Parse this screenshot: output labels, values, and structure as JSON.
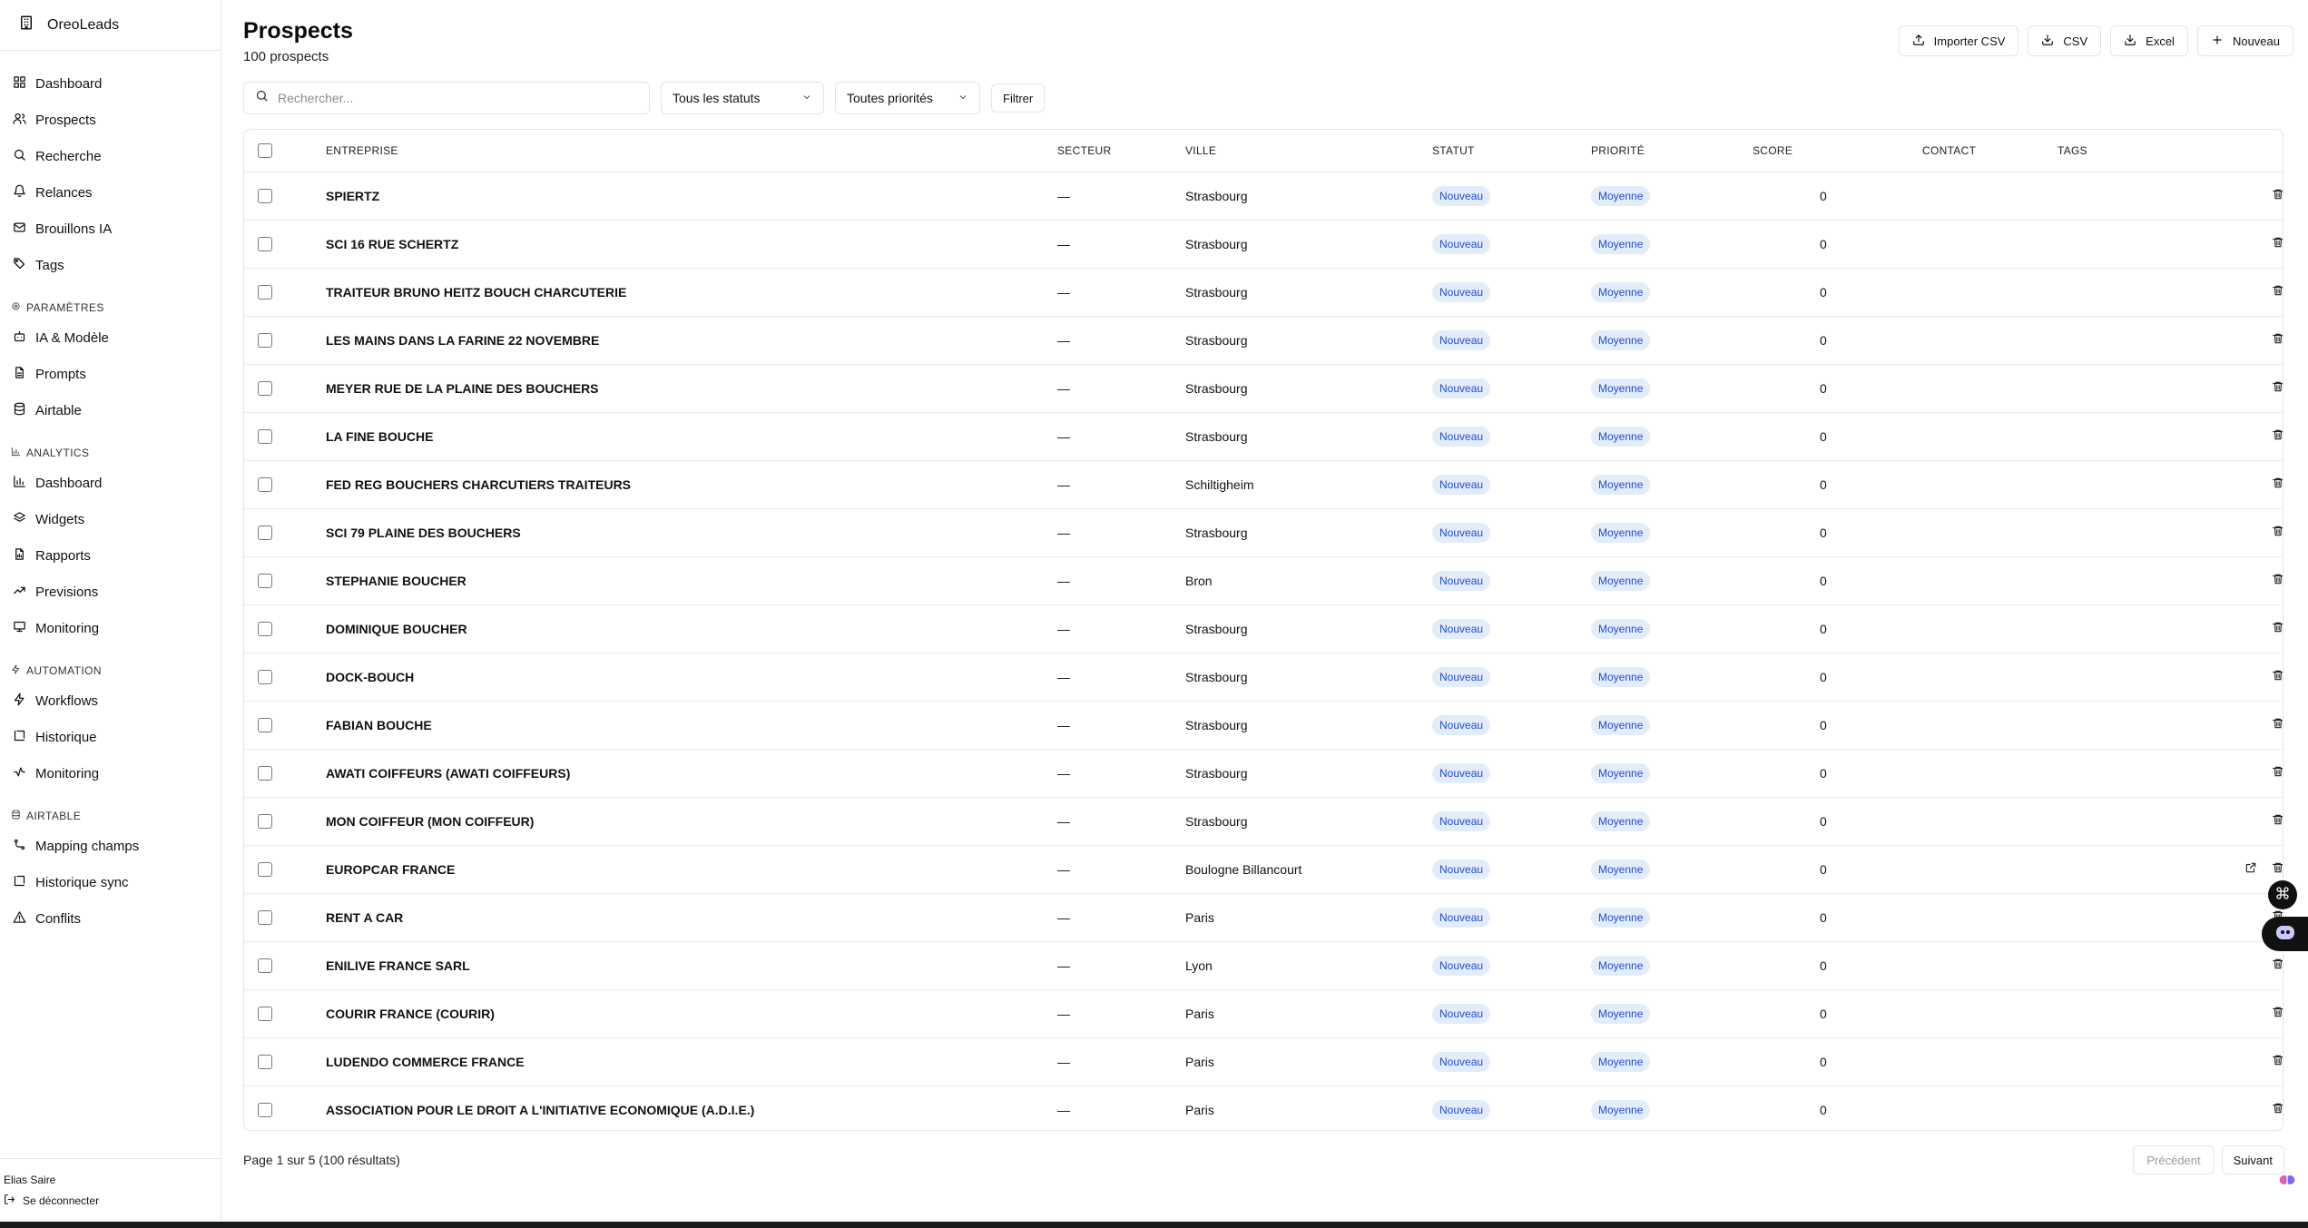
{
  "app": {
    "name": "OreoLeads"
  },
  "sidebar": {
    "main_items": [
      {
        "label": "Dashboard",
        "icon": "dashboard-icon"
      },
      {
        "label": "Prospects",
        "icon": "users-icon"
      },
      {
        "label": "Recherche",
        "icon": "search-icon"
      },
      {
        "label": "Relances",
        "icon": "bell-icon"
      },
      {
        "label": "Brouillons IA",
        "icon": "mail-icon"
      },
      {
        "label": "Tags",
        "icon": "tag-icon"
      }
    ],
    "sections": [
      {
        "label": "PARAMÈTRES",
        "icon": "gear-icon",
        "items": [
          {
            "label": "IA & Modèle",
            "icon": "bot-icon"
          },
          {
            "label": "Prompts",
            "icon": "file-icon"
          },
          {
            "label": "Airtable",
            "icon": "database-icon"
          }
        ]
      },
      {
        "label": "ANALYTICS",
        "icon": "bar-chart-icon",
        "items": [
          {
            "label": "Dashboard",
            "icon": "bar-chart-icon"
          },
          {
            "label": "Widgets",
            "icon": "layers-icon"
          },
          {
            "label": "Rapports",
            "icon": "report-icon"
          },
          {
            "label": "Previsions",
            "icon": "trending-icon"
          },
          {
            "label": "Monitoring",
            "icon": "monitor-icon"
          }
        ]
      },
      {
        "label": "AUTOMATION",
        "icon": "zap-icon",
        "items": [
          {
            "label": "Workflows",
            "icon": "zap-icon"
          },
          {
            "label": "Historique",
            "icon": "history-icon"
          },
          {
            "label": "Monitoring",
            "icon": "activity-icon"
          }
        ]
      },
      {
        "label": "AIRTABLE",
        "icon": "database-icon",
        "items": [
          {
            "label": "Mapping champs",
            "icon": "mapping-icon"
          },
          {
            "label": "Historique sync",
            "icon": "history-icon"
          },
          {
            "label": "Conflits",
            "icon": "warning-icon"
          }
        ]
      }
    ],
    "user_name": "Elias Saire",
    "logout_label": "Se déconnecter"
  },
  "header": {
    "title": "Prospects",
    "subtitle": "100 prospects",
    "actions": [
      {
        "label": "Importer CSV",
        "icon": "upload-icon",
        "name": "import-csv-button"
      },
      {
        "label": "CSV",
        "icon": "download-icon",
        "name": "export-csv-button"
      },
      {
        "label": "Excel",
        "icon": "download-icon",
        "name": "export-excel-button"
      },
      {
        "label": "Nouveau",
        "icon": "plus-icon",
        "name": "new-prospect-button"
      }
    ]
  },
  "filters": {
    "search_placeholder": "Rechercher...",
    "status_select": "Tous les statuts",
    "priority_select": "Toutes priorités",
    "filter_label": "Filtrer"
  },
  "table": {
    "columns": [
      "ENTREPRISE",
      "SECTEUR",
      "VILLE",
      "STATUT",
      "PRIORITÉ",
      "SCORE",
      "CONTACT",
      "TAGS"
    ],
    "rows": [
      {
        "company": "SPIERTZ",
        "sector": "—",
        "city": "Strasbourg",
        "status": "Nouveau",
        "priority": "Moyenne",
        "score": "0",
        "link": false
      },
      {
        "company": "SCI 16 RUE SCHERTZ",
        "sector": "—",
        "city": "Strasbourg",
        "status": "Nouveau",
        "priority": "Moyenne",
        "score": "0",
        "link": false
      },
      {
        "company": "TRAITEUR BRUNO HEITZ BOUCH CHARCUTERIE",
        "sector": "—",
        "city": "Strasbourg",
        "status": "Nouveau",
        "priority": "Moyenne",
        "score": "0",
        "link": false
      },
      {
        "company": "LES MAINS DANS LA FARINE 22 NOVEMBRE",
        "sector": "—",
        "city": "Strasbourg",
        "status": "Nouveau",
        "priority": "Moyenne",
        "score": "0",
        "link": false
      },
      {
        "company": "MEYER RUE DE LA PLAINE DES BOUCHERS",
        "sector": "—",
        "city": "Strasbourg",
        "status": "Nouveau",
        "priority": "Moyenne",
        "score": "0",
        "link": false
      },
      {
        "company": "LA FINE BOUCHE",
        "sector": "—",
        "city": "Strasbourg",
        "status": "Nouveau",
        "priority": "Moyenne",
        "score": "0",
        "link": false
      },
      {
        "company": "FED REG BOUCHERS CHARCUTIERS TRAITEURS",
        "sector": "—",
        "city": "Schiltigheim",
        "status": "Nouveau",
        "priority": "Moyenne",
        "score": "0",
        "link": false
      },
      {
        "company": "SCI 79 PLAINE DES BOUCHERS",
        "sector": "—",
        "city": "Strasbourg",
        "status": "Nouveau",
        "priority": "Moyenne",
        "score": "0",
        "link": false
      },
      {
        "company": "STEPHANIE BOUCHER",
        "sector": "—",
        "city": "Bron",
        "status": "Nouveau",
        "priority": "Moyenne",
        "score": "0",
        "link": false
      },
      {
        "company": "DOMINIQUE BOUCHER",
        "sector": "—",
        "city": "Strasbourg",
        "status": "Nouveau",
        "priority": "Moyenne",
        "score": "0",
        "link": false
      },
      {
        "company": "DOCK-BOUCH",
        "sector": "—",
        "city": "Strasbourg",
        "status": "Nouveau",
        "priority": "Moyenne",
        "score": "0",
        "link": false
      },
      {
        "company": "FABIAN BOUCHE",
        "sector": "—",
        "city": "Strasbourg",
        "status": "Nouveau",
        "priority": "Moyenne",
        "score": "0",
        "link": false
      },
      {
        "company": "AWATI COIFFEURS (AWATI COIFFEURS)",
        "sector": "—",
        "city": "Strasbourg",
        "status": "Nouveau",
        "priority": "Moyenne",
        "score": "0",
        "link": false
      },
      {
        "company": "MON COIFFEUR (MON COIFFEUR)",
        "sector": "—",
        "city": "Strasbourg",
        "status": "Nouveau",
        "priority": "Moyenne",
        "score": "0",
        "link": false
      },
      {
        "company": "EUROPCAR FRANCE",
        "sector": "—",
        "city": "Boulogne Billancourt",
        "status": "Nouveau",
        "priority": "Moyenne",
        "score": "0",
        "link": true
      },
      {
        "company": "RENT A CAR",
        "sector": "—",
        "city": "Paris",
        "status": "Nouveau",
        "priority": "Moyenne",
        "score": "0",
        "link": false
      },
      {
        "company": "ENILIVE FRANCE SARL",
        "sector": "—",
        "city": "Lyon",
        "status": "Nouveau",
        "priority": "Moyenne",
        "score": "0",
        "link": false
      },
      {
        "company": "COURIR FRANCE (COURIR)",
        "sector": "—",
        "city": "Paris",
        "status": "Nouveau",
        "priority": "Moyenne",
        "score": "0",
        "link": false
      },
      {
        "company": "LUDENDO COMMERCE FRANCE",
        "sector": "—",
        "city": "Paris",
        "status": "Nouveau",
        "priority": "Moyenne",
        "score": "0",
        "link": false
      },
      {
        "company": "ASSOCIATION POUR LE DROIT A L'INITIATIVE ECONOMIQUE (A.D.I.E.)",
        "sector": "—",
        "city": "Paris",
        "status": "Nouveau",
        "priority": "Moyenne",
        "score": "0",
        "link": false
      }
    ]
  },
  "pagination": {
    "text": "Page 1 sur 5 (100 résultats)",
    "prev_label": "Précédent",
    "next_label": "Suivant"
  },
  "colors": {
    "badge_bg": "#e3ecfb",
    "badge_text": "#1d4ed8",
    "border": "#e5e5e5"
  }
}
